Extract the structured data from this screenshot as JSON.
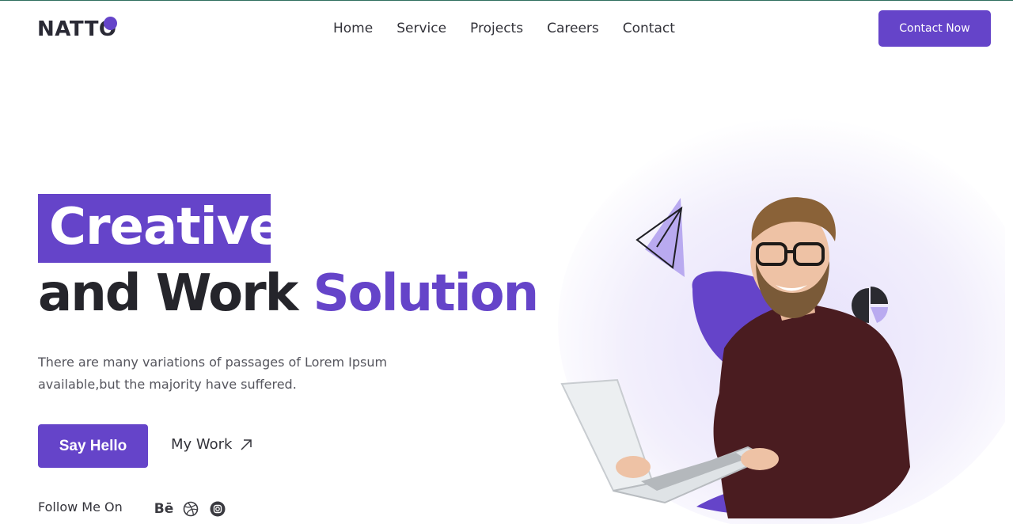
{
  "brand": {
    "logo_text": "NATTO",
    "accent": "#6544c9"
  },
  "nav": {
    "items": [
      "Home",
      "Service",
      "Projects",
      "Careers",
      "Contact"
    ]
  },
  "header": {
    "cta_label": "Contact Now"
  },
  "hero": {
    "highlight": "Creative",
    "line2_dark": "and Work",
    "line2_accent": "Solution",
    "description": "There are many variations of passages of Lorem Ipsum available,but the majority have suffered.",
    "primary_button": "Say Hello",
    "secondary_link": "My Work"
  },
  "social": {
    "label": "Follow Me On",
    "icons": [
      "behance-icon",
      "dribbble-icon",
      "instagram-icon"
    ],
    "behance_text": "Bē"
  }
}
